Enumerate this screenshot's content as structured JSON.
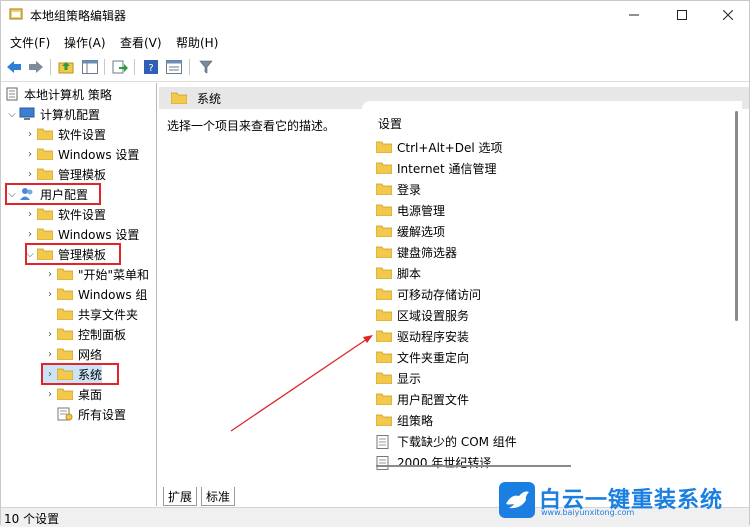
{
  "window": {
    "title": "本地组策略编辑器"
  },
  "menu": [
    "文件(F)",
    "操作(A)",
    "查看(V)",
    "帮助(H)"
  ],
  "tree": {
    "root": "本地计算机 策略",
    "computer": "计算机配置",
    "computer_children": [
      "软件设置",
      "Windows 设置",
      "管理模板"
    ],
    "user": "用户配置",
    "user_children": [
      "软件设置",
      "Windows 设置",
      "管理模板"
    ],
    "admin_children": [
      "\"开始\"菜单和",
      "Windows 组",
      "共享文件夹",
      "控制面板",
      "网络",
      "系统",
      "桌面",
      "所有设置"
    ]
  },
  "right": {
    "header": "系统",
    "description": "选择一个项目来查看它的描述。",
    "list_header": "设置",
    "items": [
      "Ctrl+Alt+Del 选项",
      "Internet 通信管理",
      "登录",
      "电源管理",
      "缓解选项",
      "键盘筛选器",
      "脚本",
      "可移动存储访问",
      "区域设置服务",
      "驱动程序安装",
      "文件夹重定向",
      "显示",
      "用户配置文件",
      "组策略",
      "下载缺少的 COM 组件",
      "2000 年世纪转译"
    ]
  },
  "tabs": [
    "扩展",
    "标准"
  ],
  "status": "10 个设置",
  "watermark": {
    "title": "白云一键重装系统",
    "url": "www.baiyunxitong.com"
  },
  "colors": {
    "highlight": "#e0252b",
    "folder": "#f2c94c",
    "accent": "#1a7fe0"
  }
}
